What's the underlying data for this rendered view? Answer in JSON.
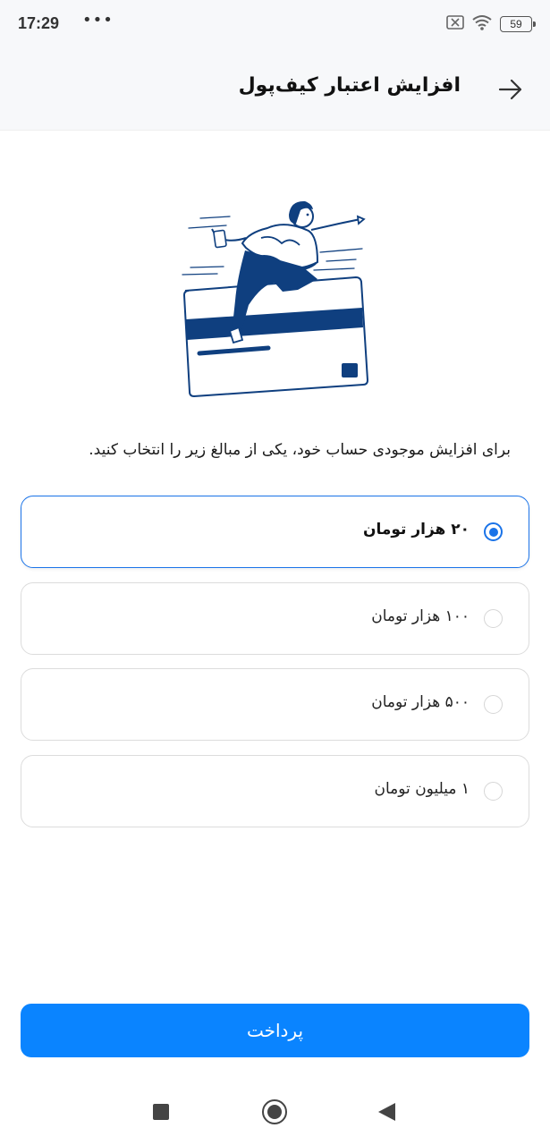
{
  "status_bar": {
    "time": "17:29",
    "dots": "•••",
    "battery": "59",
    "icons": [
      "sim-off-icon",
      "wifi-icon",
      "battery-icon"
    ]
  },
  "header": {
    "title": "افزایش اعتبار کیف‌پول",
    "back_icon": "arrow-right-icon"
  },
  "illustration": {
    "icon": "person-jumping-over-credit-card-illustration"
  },
  "instruction": "برای افزایش موجودی حساب خود، یکی از مبالغ زیر را انتخاب کنید.",
  "options": [
    {
      "label": "۲۰ هزار تومان",
      "selected": true
    },
    {
      "label": "۱۰۰ هزار تومان",
      "selected": false
    },
    {
      "label": "۵۰۰ هزار تومان",
      "selected": false
    },
    {
      "label": "۱ میلیون تومان",
      "selected": false
    }
  ],
  "pay_button": {
    "label": "پرداخت"
  },
  "colors": {
    "accent": "#0a84ff",
    "selected_border": "#1a73e8",
    "illustration_blue": "#0f3f7f"
  },
  "nav_bar": {
    "icons": [
      "recent-apps-icon",
      "home-icon",
      "back-icon"
    ]
  }
}
